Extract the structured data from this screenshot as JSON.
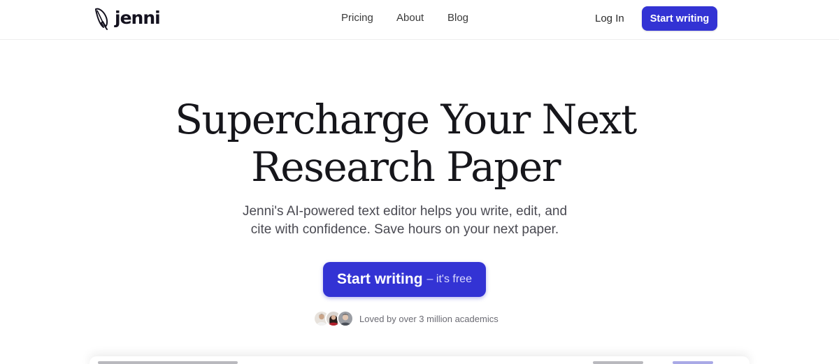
{
  "header": {
    "logo_text": "jenni",
    "logo_icon": "quill-icon",
    "nav": [
      "Pricing",
      "About",
      "Blog"
    ],
    "login_label": "Log In",
    "cta_label": "Start writing"
  },
  "hero": {
    "title_lines": [
      "Supercharge Your Next",
      "Research Paper"
    ],
    "subtitle_lines": [
      "Jenni's AI-powered text editor helps you write, edit, and",
      "cite with confidence. Save hours on your next paper."
    ],
    "cta_main": "Start writing",
    "cta_sub": "– it's free"
  },
  "social_proof": {
    "text": "Loved by over 3 million academics",
    "avatar_count": 3
  },
  "colors": {
    "brand": "#3333d4",
    "text_dark": "#16161b",
    "text_muted": "#4a4a52"
  }
}
